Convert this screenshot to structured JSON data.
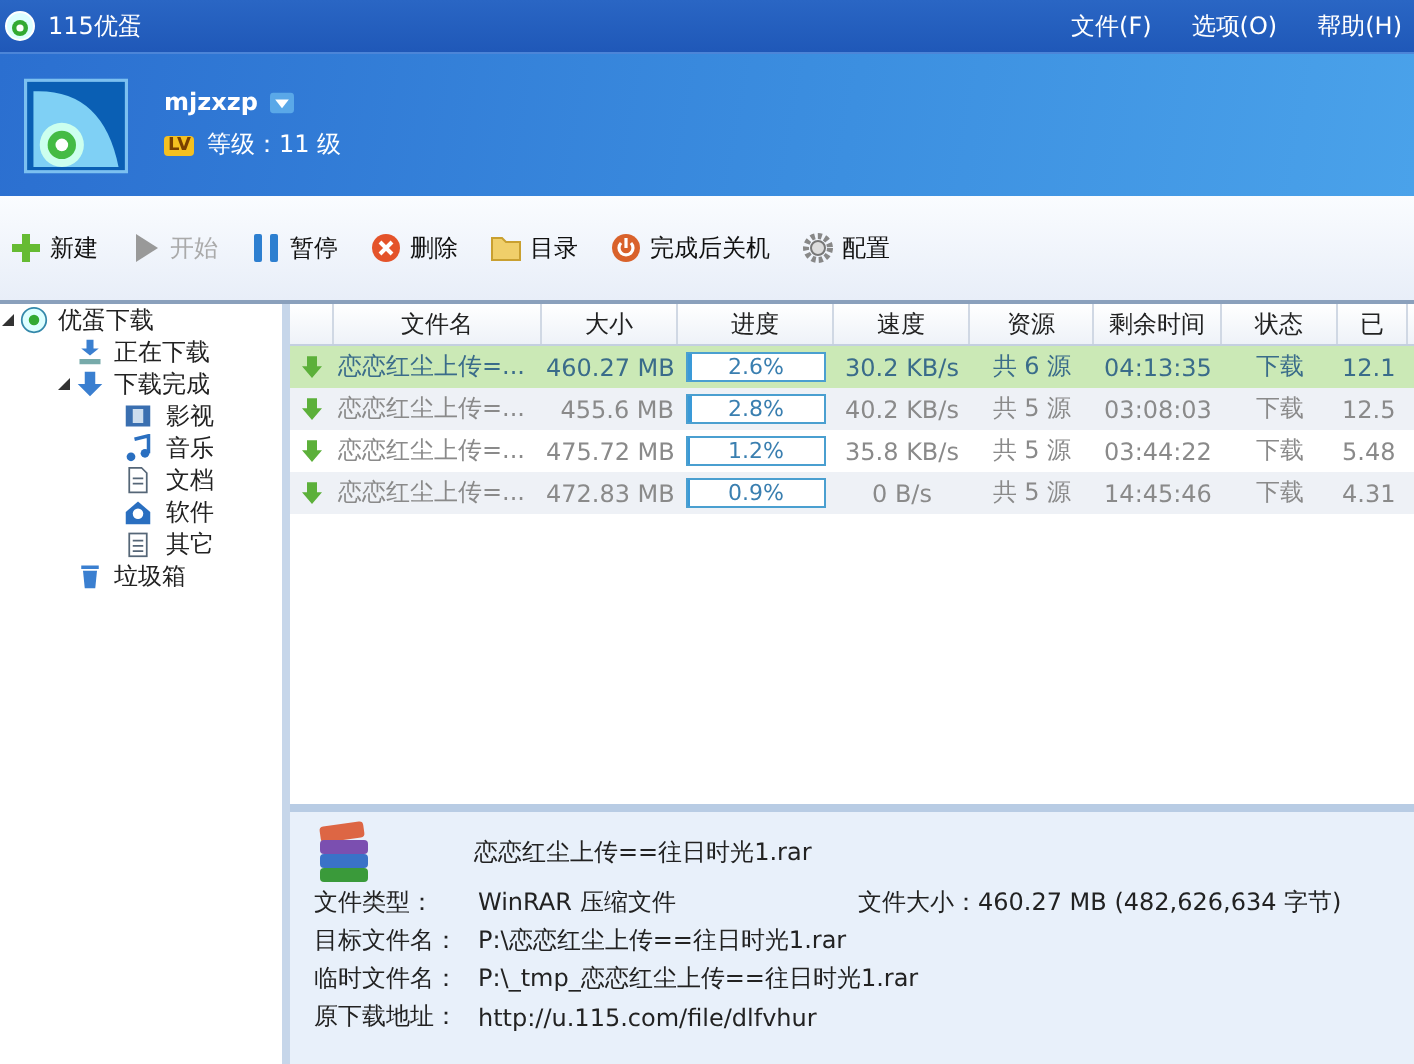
{
  "window": {
    "title": "115优蛋"
  },
  "menu": [
    {
      "label": "文件(F)"
    },
    {
      "label": "选项(O)"
    },
    {
      "label": "帮助(H)"
    }
  ],
  "user": {
    "name": "mjzxzp",
    "badge": "LV",
    "level": "等级：11 级"
  },
  "toolbar": [
    {
      "label": "新建",
      "kind": "plus",
      "disabled": false
    },
    {
      "label": "开始",
      "kind": "play",
      "disabled": true
    },
    {
      "label": "暂停",
      "kind": "pause",
      "disabled": false
    },
    {
      "label": "删除",
      "kind": "delete",
      "disabled": false
    },
    {
      "label": "目录",
      "kind": "folder",
      "disabled": false
    },
    {
      "label": "完成后关机",
      "kind": "power",
      "disabled": false
    },
    {
      "label": "配置",
      "kind": "gear",
      "disabled": false
    }
  ],
  "sidebar": {
    "items": [
      {
        "label": "优蛋下载",
        "kind": "egg",
        "expanded": true,
        "children": [
          {
            "label": "正在下载",
            "kind": "downloading"
          },
          {
            "label": "下载完成",
            "kind": "down",
            "expanded": true,
            "children": [
              {
                "label": "影视",
                "kind": "film"
              },
              {
                "label": "音乐",
                "kind": "music"
              },
              {
                "label": "文档",
                "kind": "doc"
              },
              {
                "label": "软件",
                "kind": "software"
              },
              {
                "label": "其它",
                "kind": "note"
              }
            ]
          },
          {
            "label": "垃圾箱",
            "kind": "trash"
          }
        ]
      }
    ]
  },
  "table": {
    "columns": [
      "文件名",
      "大小",
      "进度",
      "速度",
      "资源",
      "剩余时间",
      "状态",
      "已"
    ],
    "rows": [
      {
        "selected": true,
        "name": "恋恋红尘上传=...",
        "size": "460.27 MB",
        "level": 0.026,
        "progress": "2.6%",
        "speed": "30.2 KB/s",
        "sources": "共 6 源",
        "remaining": "04:13:35",
        "status": "下载",
        "column_9": "12.1"
      },
      {
        "selected": false,
        "name": "恋恋红尘上传=...",
        "size": "455.6 MB",
        "level": 0.028,
        "progress": "2.8%",
        "speed": "40.2 KB/s",
        "sources": "共 5 源",
        "remaining": "03:08:03",
        "status": "下载",
        "column_9": "12.5"
      },
      {
        "selected": false,
        "name": "恋恋红尘上传=...",
        "size": "475.72 MB",
        "level": 0.012,
        "progress": "1.2%",
        "speed": "35.8 KB/s",
        "sources": "共 5 源",
        "remaining": "03:44:22",
        "status": "下载",
        "column_9": "5.48"
      },
      {
        "selected": false,
        "name": "恋恋红尘上传=...",
        "size": "472.83 MB",
        "level": 0.009,
        "progress": "0.9%",
        "speed": "0 B/s",
        "sources": "共 5 源",
        "remaining": "14:45:46",
        "status": "下载",
        "column_9": "4.31"
      }
    ]
  },
  "details": {
    "file_name": "恋恋红尘上传==往日时光1.rar",
    "type_label": "文件类型：",
    "type_value": "WinRAR 压缩文件",
    "size_label": "文件大小：",
    "size_value": "460.27 MB (482,626,634 字节)",
    "fields": [
      {
        "label": "目标文件名：",
        "value": "P:\\恋恋红尘上传==往日时光1.rar"
      },
      {
        "label": "临时文件名：",
        "value": "P:\\_tmp_恋恋红尘上传==往日时光1.rar"
      },
      {
        "label": "原下载地址：",
        "value": "http://u.115.com/file/dlfvhur"
      }
    ]
  }
}
